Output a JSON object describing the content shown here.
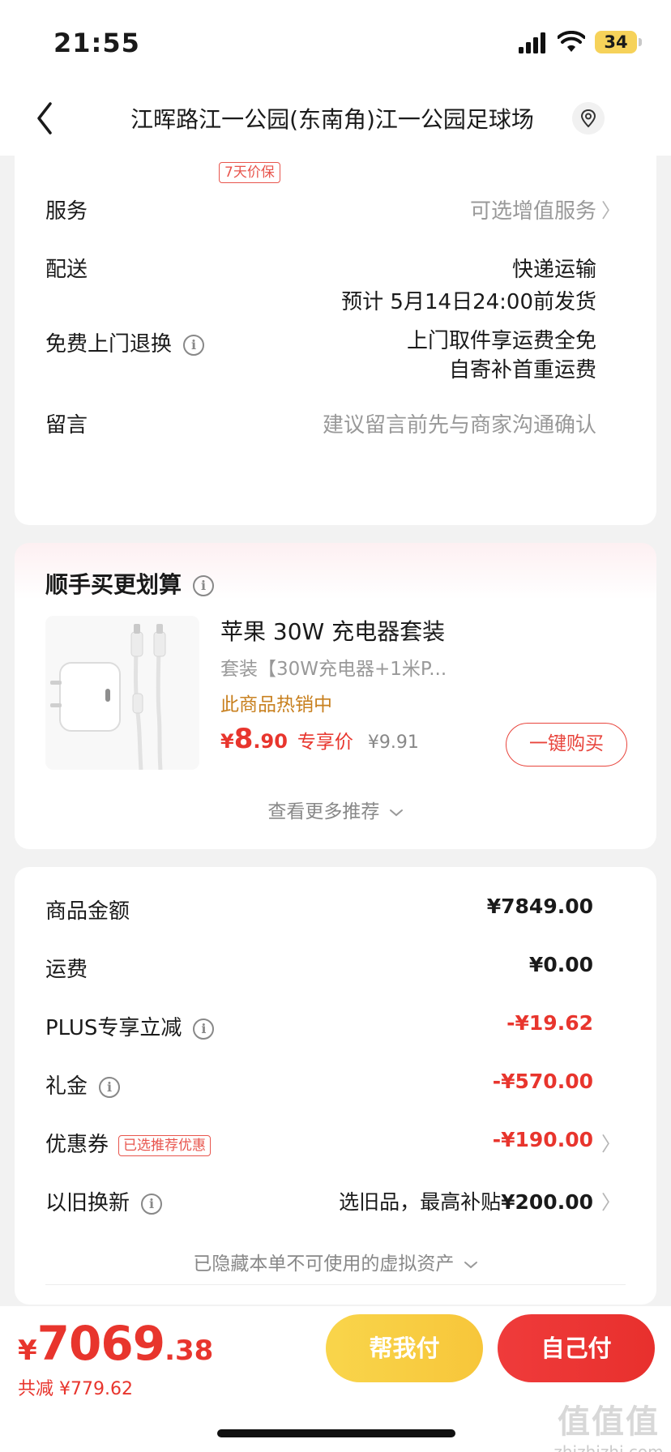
{
  "status_bar": {
    "time": "21:55",
    "battery": "34"
  },
  "nav": {
    "title": "江晖路江一公园(东南角)江一公园足球场"
  },
  "order_info": {
    "price_protect_tag": "7天价保",
    "service": {
      "label": "服务",
      "value": "可选增值服务"
    },
    "delivery": {
      "label": "配送",
      "method": "快递运输",
      "estimate": "预计 5月14日24:00前发货"
    },
    "free_return": {
      "label": "免费上门退换",
      "line1": "上门取件享运费全免",
      "line2": "自寄补首重运费"
    },
    "message": {
      "label": "留言",
      "placeholder": "建议留言前先与商家沟通确认"
    }
  },
  "recommend": {
    "title": "顺手买更划算",
    "product": {
      "name": "苹果 30W 充电器套装",
      "spec": "套装【30W充电器+1米P...",
      "hot": "此商品热销中",
      "price_yen": "¥",
      "price_int": "8",
      "price_dec": ".90",
      "price_tag": "专享价",
      "orig_price": "¥9.91",
      "buy_label": "一键购买"
    },
    "see_more": "查看更多推荐"
  },
  "summary": {
    "goods": {
      "label": "商品金额",
      "value": "¥7849.00"
    },
    "shipping": {
      "label": "运费",
      "value": "¥0.00"
    },
    "plus": {
      "label": "PLUS专享立减",
      "value": "-¥19.62"
    },
    "gift": {
      "label": "礼金",
      "value": "-¥570.00"
    },
    "coupon": {
      "label": "优惠券",
      "tag": "已选推荐优惠",
      "value": "-¥190.00"
    },
    "trade_in": {
      "label": "以旧换新",
      "value_prefix": "选旧品，最高补贴",
      "value_amount": "¥200.00"
    },
    "hidden_assets": "已隐藏本单不可使用的虚拟资产"
  },
  "bottom": {
    "total_yen": "¥",
    "total_int": "7069",
    "total_dec": ".38",
    "saved": "共减 ¥779.62",
    "help_pay": "帮我付",
    "self_pay": "自己付"
  },
  "watermark": {
    "main": "值值值",
    "sub": "zhizhizhi.com"
  },
  "colors": {
    "accent_red": "#e8352d",
    "yellow_button": "#f9d54b",
    "hot_text": "#c8801f"
  }
}
